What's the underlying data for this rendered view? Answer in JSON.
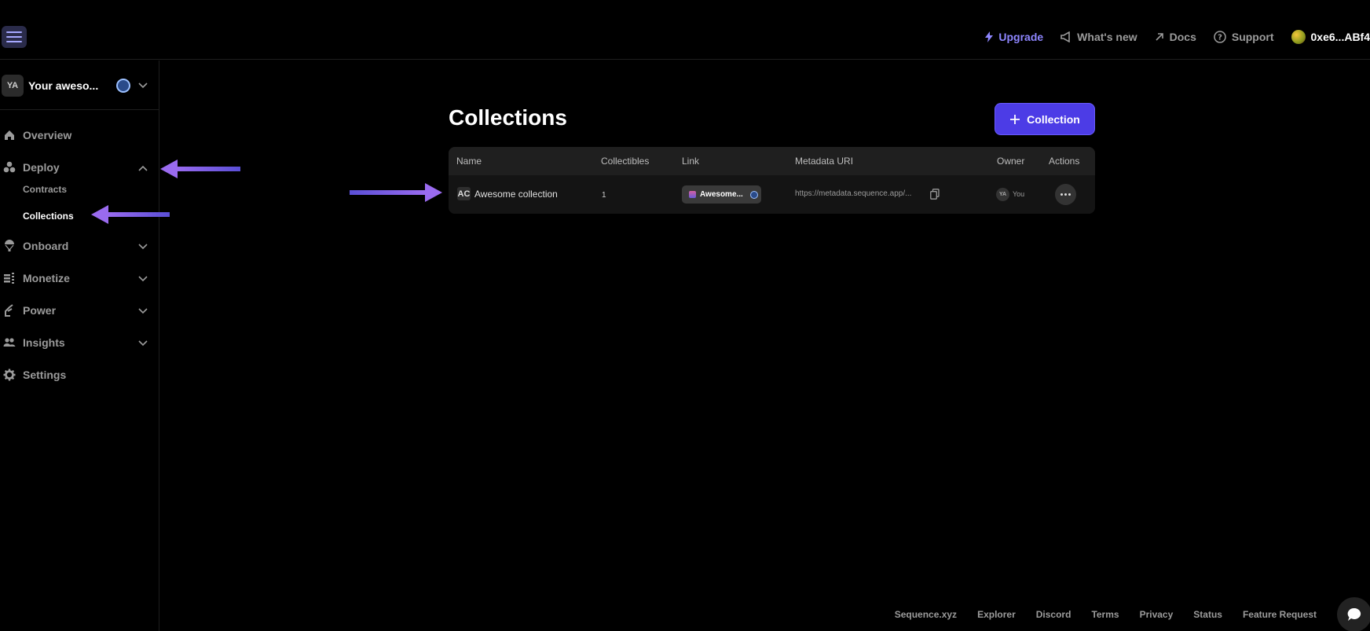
{
  "topbar": {
    "upgrade": "Upgrade",
    "whats_new": "What's new",
    "docs": "Docs",
    "support": "Support",
    "wallet": "0xe6...ABf4",
    "upgrade_color": "#8e86ff"
  },
  "sidebar": {
    "project_avatar": "YA",
    "project_name": "Your aweso...",
    "items": [
      {
        "label": "Overview",
        "icon": "home-icon"
      },
      {
        "label": "Deploy",
        "icon": "deploy-icon",
        "expanded": true,
        "children": [
          "Contracts",
          "Collections"
        ]
      },
      {
        "label": "Onboard",
        "icon": "onboard-icon",
        "expanded": false
      },
      {
        "label": "Monetize",
        "icon": "monetize-icon",
        "expanded": false
      },
      {
        "label": "Power",
        "icon": "power-icon",
        "expanded": false
      },
      {
        "label": "Insights",
        "icon": "insights-icon",
        "expanded": false
      },
      {
        "label": "Settings",
        "icon": "gear-icon"
      }
    ],
    "active_subitem": "Collections"
  },
  "main": {
    "title": "Collections",
    "add_button": "Collection",
    "accent": "#4c3ce6",
    "table": {
      "columns": [
        "Name",
        "Collectibles",
        "Link",
        "Metadata URI",
        "Owner",
        "Actions"
      ],
      "rows": [
        {
          "badge": "AC",
          "name": "Awesome collection",
          "collectibles": "1",
          "link": "Awesome...",
          "metadata_uri": "https://metadata.sequence.app/...",
          "owner_avatar": "YA",
          "owner": "You"
        }
      ]
    }
  },
  "annotation_color": "#8a63e8",
  "footer": {
    "links": [
      "Sequence.xyz",
      "Explorer",
      "Discord",
      "Terms",
      "Privacy",
      "Status",
      "Feature Request"
    ]
  }
}
